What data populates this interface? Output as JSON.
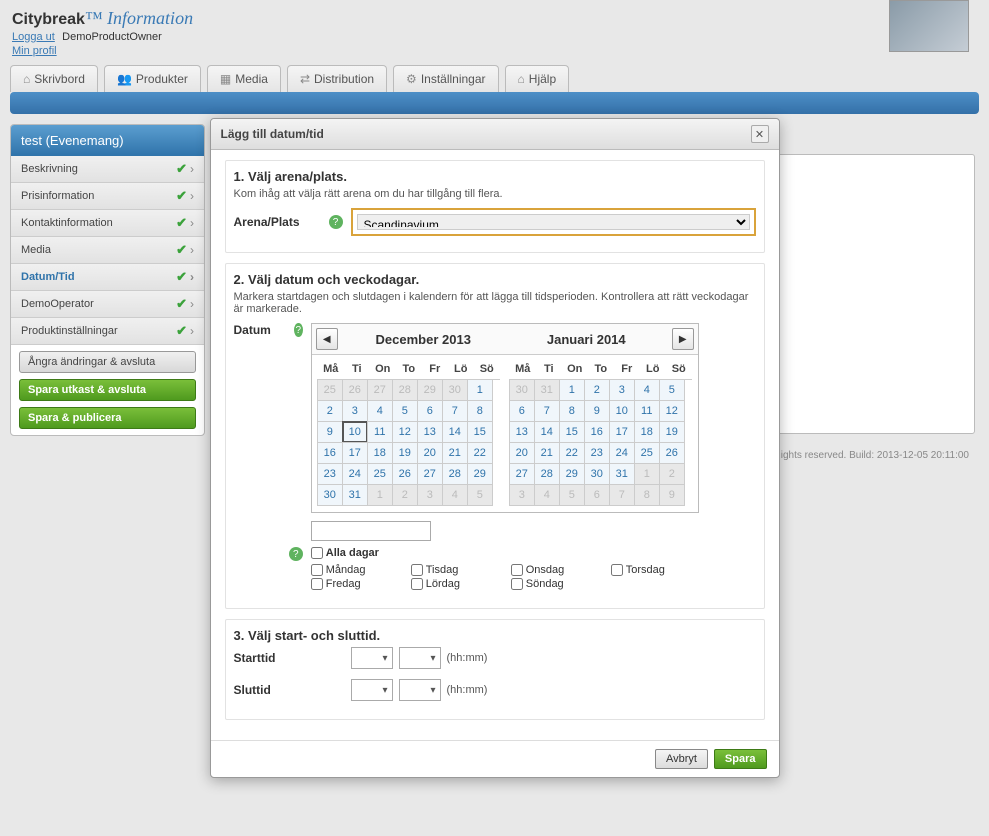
{
  "brand": {
    "name": "Citybreak",
    "suffix": "™ Information"
  },
  "user": {
    "logout": "Logga ut",
    "name": "DemoProductOwner",
    "profile": "Min profil"
  },
  "tabs": [
    "Skrivbord",
    "Produkter",
    "Media",
    "Distribution",
    "Inställningar",
    "Hjälp"
  ],
  "sidebar": {
    "title": "test (Evenemang)",
    "items": [
      "Beskrivning",
      "Prisinformation",
      "Kontaktinformation",
      "Media",
      "Datum/Tid",
      "DemoOperator",
      "Produktinställningar"
    ],
    "active": 4,
    "btn_undo": "Ångra ändringar & avsluta",
    "btn_save_exit": "Spara utkast & avsluta",
    "btn_save_pub": "Spara & publicera"
  },
  "footer": "ights reserved. Build: 2013-12-05 20:11:00",
  "dialog": {
    "title": "Lägg till datum/tid",
    "sec1_title": "1. Välj arena/plats.",
    "sec1_sub": "Kom ihåg att välja rätt arena om du har tillgång till flera.",
    "arena_label": "Arena/Plats",
    "arena_value": "Scandinavium",
    "sec2_title": "2. Välj datum och veckodagar.",
    "sec2_sub": "Markera startdagen och slutdagen i kalendern för att lägga till tidsperioden. Kontrollera att rätt veckodagar är markerade.",
    "date_label": "Datum",
    "month1": "December 2013",
    "month2": "Januari 2014",
    "weekdays": [
      "Må",
      "Ti",
      "On",
      "To",
      "Fr",
      "Lö",
      "Sö"
    ],
    "cal1": [
      {
        "d": 25,
        "o": 1
      },
      {
        "d": 26,
        "o": 1
      },
      {
        "d": 27,
        "o": 1
      },
      {
        "d": 28,
        "o": 1
      },
      {
        "d": 29,
        "o": 1
      },
      {
        "d": 30,
        "o": 1
      },
      {
        "d": 1
      },
      {
        "d": 2
      },
      {
        "d": 3
      },
      {
        "d": 4
      },
      {
        "d": 5
      },
      {
        "d": 6
      },
      {
        "d": 7
      },
      {
        "d": 8
      },
      {
        "d": 9
      },
      {
        "d": 10,
        "t": 1
      },
      {
        "d": 11
      },
      {
        "d": 12
      },
      {
        "d": 13
      },
      {
        "d": 14
      },
      {
        "d": 15
      },
      {
        "d": 16
      },
      {
        "d": 17
      },
      {
        "d": 18
      },
      {
        "d": 19
      },
      {
        "d": 20
      },
      {
        "d": 21
      },
      {
        "d": 22
      },
      {
        "d": 23
      },
      {
        "d": 24
      },
      {
        "d": 25
      },
      {
        "d": 26
      },
      {
        "d": 27
      },
      {
        "d": 28
      },
      {
        "d": 29
      },
      {
        "d": 30
      },
      {
        "d": 31
      },
      {
        "d": 1,
        "o": 1
      },
      {
        "d": 2,
        "o": 1
      },
      {
        "d": 3,
        "o": 1
      },
      {
        "d": 4,
        "o": 1
      },
      {
        "d": 5,
        "o": 1
      }
    ],
    "cal2": [
      {
        "d": 30,
        "o": 1
      },
      {
        "d": 31,
        "o": 1
      },
      {
        "d": 1
      },
      {
        "d": 2
      },
      {
        "d": 3
      },
      {
        "d": 4
      },
      {
        "d": 5
      },
      {
        "d": 6
      },
      {
        "d": 7
      },
      {
        "d": 8
      },
      {
        "d": 9
      },
      {
        "d": 10
      },
      {
        "d": 11
      },
      {
        "d": 12
      },
      {
        "d": 13
      },
      {
        "d": 14
      },
      {
        "d": 15
      },
      {
        "d": 16
      },
      {
        "d": 17
      },
      {
        "d": 18
      },
      {
        "d": 19
      },
      {
        "d": 20
      },
      {
        "d": 21
      },
      {
        "d": 22
      },
      {
        "d": 23
      },
      {
        "d": 24
      },
      {
        "d": 25
      },
      {
        "d": 26
      },
      {
        "d": 27
      },
      {
        "d": 28
      },
      {
        "d": 29
      },
      {
        "d": 30
      },
      {
        "d": 31
      },
      {
        "d": 1,
        "o": 1
      },
      {
        "d": 2,
        "o": 1
      },
      {
        "d": 3,
        "o": 1
      },
      {
        "d": 4,
        "o": 1
      },
      {
        "d": 5,
        "o": 1
      },
      {
        "d": 6,
        "o": 1
      },
      {
        "d": 7,
        "o": 1
      },
      {
        "d": 8,
        "o": 1
      },
      {
        "d": 9,
        "o": 1
      }
    ],
    "alldays": "Alla dagar",
    "wd_full": [
      "Måndag",
      "Tisdag",
      "Onsdag",
      "Torsdag",
      "Fredag",
      "Lördag",
      "Söndag"
    ],
    "sec3_title": "3. Välj start- och sluttid.",
    "starttime": "Starttid",
    "endtime": "Sluttid",
    "hhmm": "(hh:mm)",
    "cancel": "Avbryt",
    "save": "Spara"
  }
}
